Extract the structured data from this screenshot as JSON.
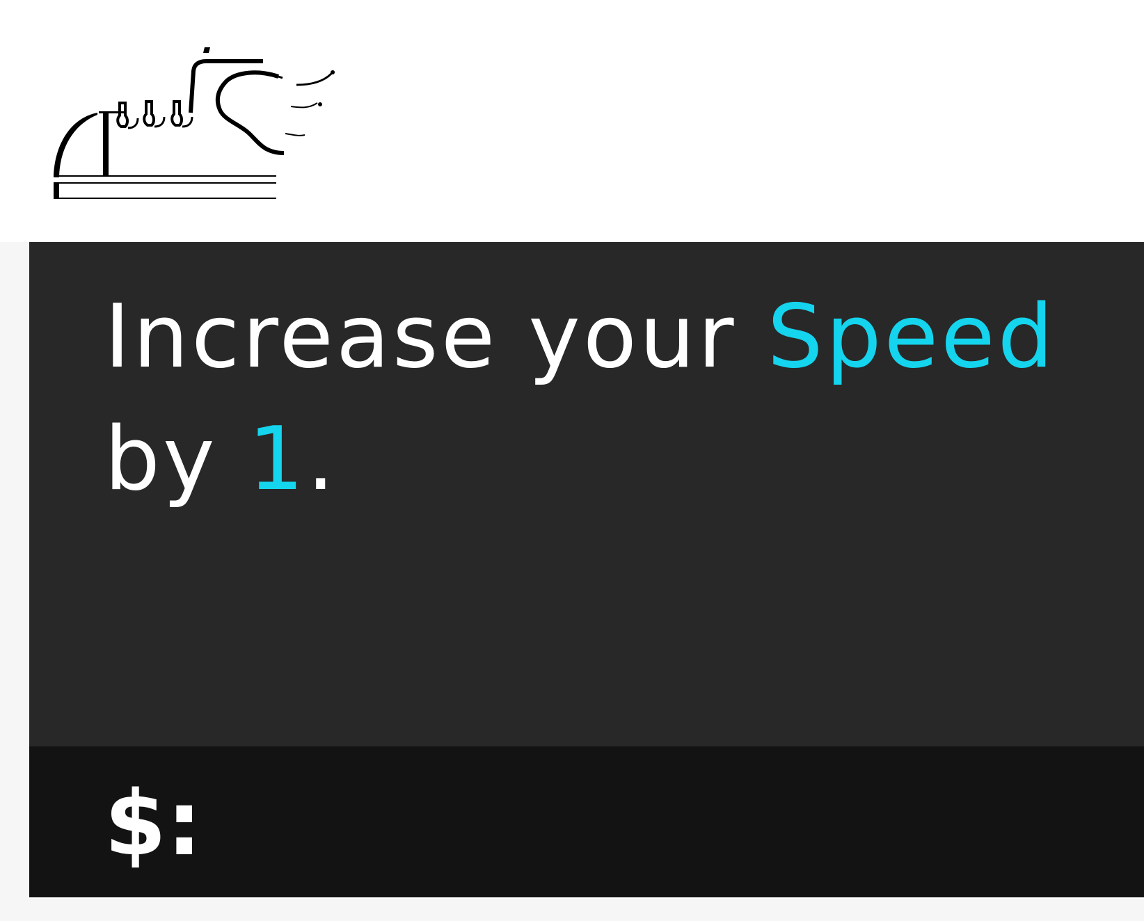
{
  "card": {
    "icon": "winged-boot-icon",
    "text_parts": {
      "p1": "Increase your ",
      "p2": "Speed",
      "p3": " by ",
      "p4": "1",
      "p5": "."
    },
    "cost_label": "$:"
  },
  "colors": {
    "card_background": "#282828",
    "cost_bar": "#131313",
    "highlight": "#14d4ee",
    "text": "#ffffff"
  }
}
